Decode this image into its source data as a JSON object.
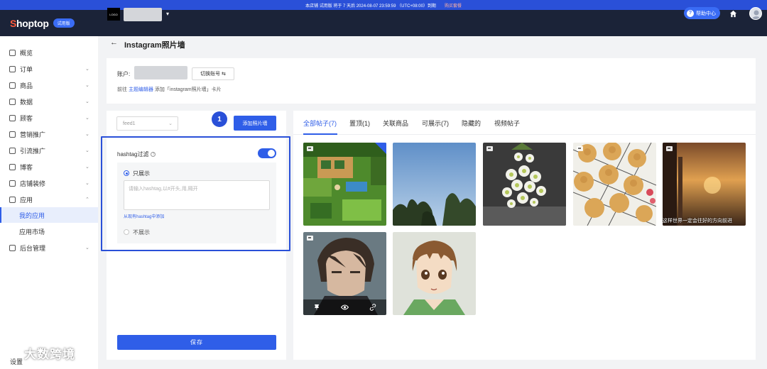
{
  "banner": {
    "text": "本店铺 试用版 将于 7 天后 2024-08-07 23:59:59 （UTC+08:00）到期",
    "buy": "购买套餐"
  },
  "topbar": {
    "brand_s": "S",
    "brand_rest": "hoptop",
    "trial_badge": "试用版",
    "store_logo": "LOGO",
    "help": "帮助中心",
    "help_icon_glyph": "?",
    "caret": "▾"
  },
  "sidebar": {
    "items": [
      {
        "label": "概览",
        "chevron": ""
      },
      {
        "label": "订单",
        "chevron": "⌄"
      },
      {
        "label": "商品",
        "chevron": "⌄"
      },
      {
        "label": "数据",
        "chevron": "⌄"
      },
      {
        "label": "顾客",
        "chevron": "⌄"
      },
      {
        "label": "营销推广",
        "chevron": "⌄"
      },
      {
        "label": "引流推广",
        "chevron": "⌄"
      },
      {
        "label": "博客",
        "chevron": "⌄"
      },
      {
        "label": "店铺装修",
        "chevron": "⌄"
      },
      {
        "label": "应用",
        "chevron": "⌃"
      },
      {
        "label": "我的应用",
        "chevron": ""
      },
      {
        "label": "应用市场",
        "chevron": ""
      },
      {
        "label": "后台管理",
        "chevron": "⌄"
      }
    ],
    "settings": "设置"
  },
  "page": {
    "back": "←",
    "title": "Instagram照片墙"
  },
  "account": {
    "label": "账户:",
    "switch": "切换账号 ⇆",
    "hint_prefix": "前往 ",
    "hint_link": "主题编辑器",
    "hint_suffix": " 添加「instagram照片墙」卡片"
  },
  "left": {
    "feed_value": "feed1",
    "caret": "⌄",
    "step": "1",
    "add_button": "添加照片墙",
    "hashtag_label": "hashtag过滤",
    "info_glyph": "?",
    "only_show": "只展示",
    "input_placeholder": "请输入hashtag,以#开头,用,隔开",
    "from_existing": "从现有hashtag中添加",
    "not_show": "不展示",
    "save": "保存"
  },
  "tabs": [
    {
      "label": "全部帖子(7)"
    },
    {
      "label": "置顶(1)"
    },
    {
      "label": "关联商品"
    },
    {
      "label": "可展示(7)"
    },
    {
      "label": "隐藏的"
    },
    {
      "label": "视频帖子"
    }
  ],
  "photos": {
    "caption5": "这样世界一定会往好的方向前进",
    "action_pin": "⊥",
    "action_eye": "◉",
    "action_link": "⚭"
  },
  "watermark": "大数跨境"
}
